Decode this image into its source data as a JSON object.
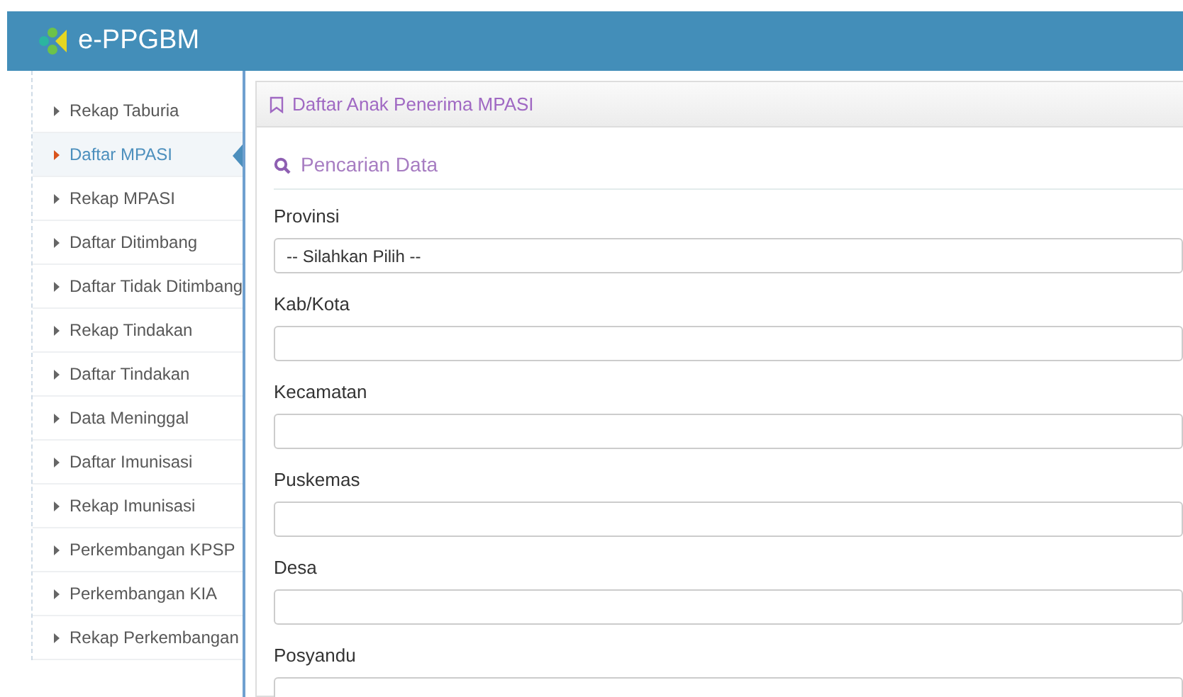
{
  "header": {
    "app_name": "e-PPGBM"
  },
  "sidebar": {
    "items": [
      {
        "label": "Rekap Taburia",
        "selected": false
      },
      {
        "label": "Daftar MPASI",
        "selected": true
      },
      {
        "label": "Rekap MPASI",
        "selected": false
      },
      {
        "label": "Daftar Ditimbang",
        "selected": false
      },
      {
        "label": "Daftar Tidak Ditimbang",
        "selected": false
      },
      {
        "label": "Rekap Tindakan",
        "selected": false
      },
      {
        "label": "Daftar Tindakan",
        "selected": false
      },
      {
        "label": "Data Meninggal",
        "selected": false
      },
      {
        "label": "Daftar Imunisasi",
        "selected": false
      },
      {
        "label": "Rekap Imunisasi",
        "selected": false
      },
      {
        "label": "Perkembangan KPSP",
        "selected": false
      },
      {
        "label": "Perkembangan KIA",
        "selected": false
      },
      {
        "label": "Rekap Perkembangan",
        "selected": false
      }
    ]
  },
  "panel": {
    "title": "Daftar Anak Penerima MPASI",
    "section_title": "Pencarian Data",
    "fields": [
      {
        "label": "Provinsi",
        "kind": "select",
        "value": "-- Silahkan Pilih --"
      },
      {
        "label": "Kab/Kota",
        "kind": "input"
      },
      {
        "label": "Kecamatan",
        "kind": "input"
      },
      {
        "label": "Puskemas",
        "kind": "input"
      },
      {
        "label": "Desa",
        "kind": "input"
      },
      {
        "label": "Posyandu",
        "kind": "input"
      }
    ]
  }
}
